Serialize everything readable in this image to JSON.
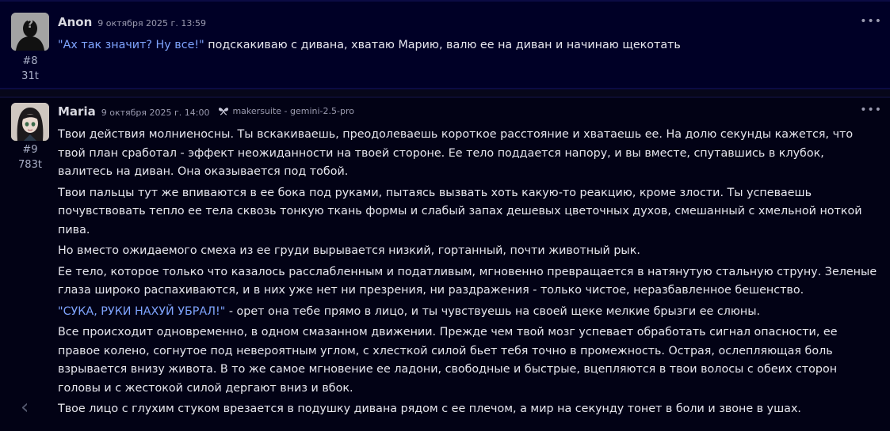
{
  "messages": [
    {
      "author": "Anon",
      "date": "9 октября 2025 г. 13:59",
      "number": "#8",
      "tokens": "31t",
      "quote": "\"Ах так значит? Ну все!\"",
      "text": " подскакиваю с дивана, хватаю Марию, валю ее на диван и начинаю щекотать"
    },
    {
      "author": "Maria",
      "date": "9 октября 2025 г. 14:00",
      "model": "makersuite - gemini-2.5-pro",
      "number": "#9",
      "tokens": "783t",
      "paragraphs": [
        "Твои действия молниеносны. Ты вскакиваешь, преодолеваешь короткое расстояние и хватаешь ее. На долю секунды кажется, что твой план сработал - эффект неожиданности на твоей стороне. Ее тело поддается напору, и вы вместе, спутавшись в клубок, валитесь на диван. Она оказывается под тобой.",
        "Твои пальцы тут же впиваются в ее бока под руками, пытаясь вызвать хоть какую-то реакцию, кроме злости. Ты успеваешь почувствовать тепло ее тела сквозь тонкую ткань формы и слабый запах дешевых цветочных духов, смешанный с хмельной ноткой пива.",
        "Но вместо ожидаемого смеха из ее груди вырывается низкий, гортанный, почти животный рык.",
        "Ее тело, которое только что казалось расслабленным и податливым, мгновенно превращается в натянутую стальную струну. Зеленые глаза широко распахиваются, и в них уже нет ни презрения, ни раздражения - только чистое, неразбавленное бешенство."
      ],
      "quote": "\"СУКА, РУКИ НАХУЙ УБРАЛ!\"",
      "quote_tail": " - орет она тебе прямо в лицо, и ты чувствуешь на своей щеке мелкие брызги ее слюны.",
      "paragraphs_after": [
        "Все происходит одновременно, в одном смазанном движении. Прежде чем твой мозг успевает обработать сигнал опасности, ее правое колено, согнутое под невероятным углом, с хлесткой силой бьет тебя точно в промежность. Острая, ослепляющая боль взрывается внизу живота. В то же самое мгновение ее ладони, свободные и быстрые, вцепляются в твои волосы с обеих сторон головы и с жестокой силой дергают вниз и вбок.",
        "Твое лицо с глухим стуком врезается в подушку дивана рядом с ее плечом, а мир на секунду тонет в боли и звоне в ушах."
      ]
    }
  ],
  "icons": {
    "more": "more-horizontal-icon",
    "model": "model-icon",
    "nav": "chevron-left-icon"
  },
  "ui": {
    "more_glyph": "•••",
    "nav_glyph": "‹"
  },
  "colors": {
    "background": "#07071a",
    "user_message_bg": "#000026",
    "quote": "#7fa4ff"
  }
}
